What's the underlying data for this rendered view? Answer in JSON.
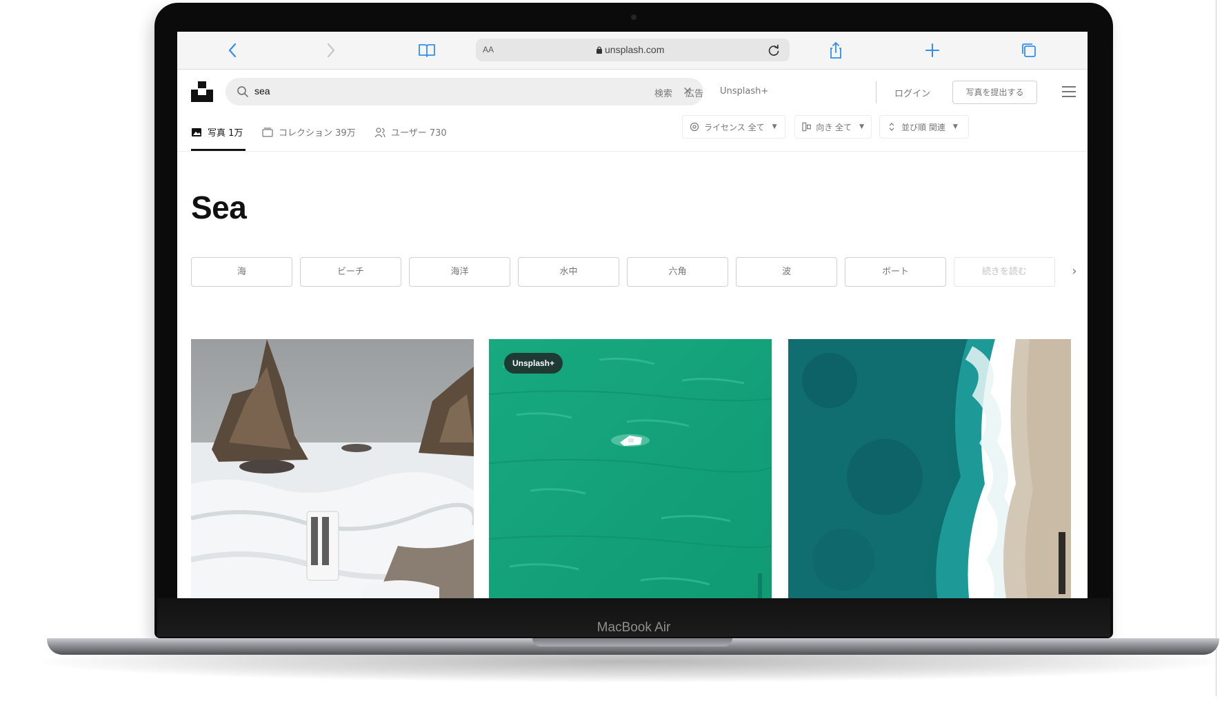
{
  "browser": {
    "address_aa": "AA",
    "url": "unsplash.com"
  },
  "header": {
    "search_value": "sea",
    "clear_glyph": "×",
    "links": [
      "検索",
      "広告",
      "Unsplash+"
    ],
    "login": "ログイン",
    "submit_photo": "写真を提出する"
  },
  "result_tabs": [
    {
      "label": "写真 1万",
      "icon": "photo-icon",
      "active": true
    },
    {
      "label": "コレクション 39万",
      "icon": "collection-icon",
      "active": false
    },
    {
      "label": "ユーザー 730",
      "icon": "users-icon",
      "active": false
    }
  ],
  "filters": [
    {
      "label": "ライセンス 全て",
      "icon": "license-icon"
    },
    {
      "label": "向き 全て",
      "icon": "orientation-icon"
    },
    {
      "label": "並び順 関連",
      "icon": "sort-icon"
    }
  ],
  "page_title": "Sea",
  "related_chips": [
    "海",
    "ビーチ",
    "海洋",
    "水中",
    "六角",
    "波",
    "ボート",
    "続きを読む"
  ],
  "chip_next_glyph": "›",
  "photos": [
    {
      "subject": "rocky-shore-foam",
      "badge": ""
    },
    {
      "subject": "boat-turquoise-sea",
      "badge": "Unsplash+"
    },
    {
      "subject": "aerial-waves-beach",
      "badge": ""
    }
  ],
  "device_label": "MacBook Air",
  "colors": {
    "browser_accent": "#2f8ef5",
    "plus_badge": "#1f3a32",
    "sea_green": "#1fa57e"
  }
}
